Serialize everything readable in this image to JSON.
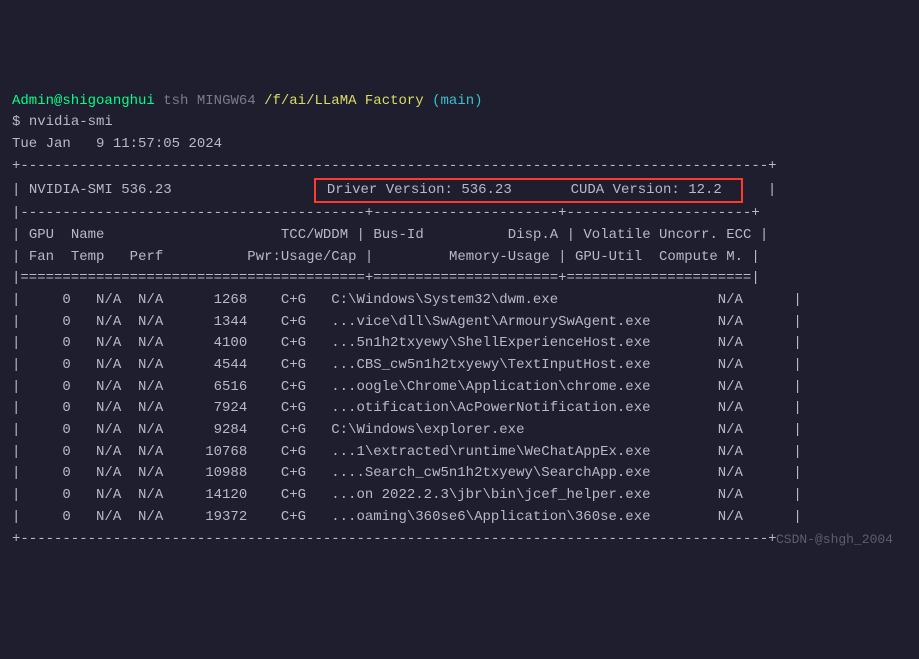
{
  "ps1": {
    "user_host": "Admin@shigoanghui",
    "shell": "tsh",
    "sys": "MINGW64",
    "cwd": "/f/ai/LLaMA Factory",
    "branch": "(main)"
  },
  "prompt": "$ ",
  "command": "nvidia-smi",
  "date": "Tue Jan   9 11:57:05 2024",
  "smi_label": "NVIDIA-SMI",
  "smi_version": "536.23",
  "driver_label": "Driver Version:",
  "driver_version": "536.23",
  "cuda_label": "CUDA Version:",
  "cuda_version": "12.2",
  "hdr": {
    "gpu": "GPU",
    "name": "Name",
    "tccwddm": "TCC/WDDM",
    "busid": "Bus-Id",
    "dispa": "Disp.A",
    "volatile": "Volatile",
    "uncorr_ecc": "Uncorr. ECC",
    "fan": "Fan",
    "temp": "Temp",
    "perf": "Perf",
    "pwr": "Pwr:Usage/Cap",
    "memusage": "Memory-Usage",
    "gpuutil": "GPU-Util",
    "computem": "Compute M."
  },
  "procs": [
    {
      "gpu": "0",
      "col1": "N/A",
      "col2": "N/A",
      "pid": "1268",
      "type": "C+G",
      "path": "C:\\Windows\\System32\\dwm.exe",
      "mem": "N/A"
    },
    {
      "gpu": "0",
      "col1": "N/A",
      "col2": "N/A",
      "pid": "1344",
      "type": "C+G",
      "path": "...vice\\dll\\SwAgent\\ArmourySwAgent.exe",
      "mem": "N/A"
    },
    {
      "gpu": "0",
      "col1": "N/A",
      "col2": "N/A",
      "pid": "4100",
      "type": "C+G",
      "path": "...5n1h2txyewy\\ShellExperienceHost.exe",
      "mem": "N/A"
    },
    {
      "gpu": "0",
      "col1": "N/A",
      "col2": "N/A",
      "pid": "4544",
      "type": "C+G",
      "path": "...CBS_cw5n1h2txyewy\\TextInputHost.exe",
      "mem": "N/A"
    },
    {
      "gpu": "0",
      "col1": "N/A",
      "col2": "N/A",
      "pid": "6516",
      "type": "C+G",
      "path": "...oogle\\Chrome\\Application\\chrome.exe",
      "mem": "N/A"
    },
    {
      "gpu": "0",
      "col1": "N/A",
      "col2": "N/A",
      "pid": "7924",
      "type": "C+G",
      "path": "...otification\\AcPowerNotification.exe",
      "mem": "N/A"
    },
    {
      "gpu": "0",
      "col1": "N/A",
      "col2": "N/A",
      "pid": "9284",
      "type": "C+G",
      "path": "C:\\Windows\\explorer.exe",
      "mem": "N/A"
    },
    {
      "gpu": "0",
      "col1": "N/A",
      "col2": "N/A",
      "pid": "10768",
      "type": "C+G",
      "path": "...1\\extracted\\runtime\\WeChatAppEx.exe",
      "mem": "N/A"
    },
    {
      "gpu": "0",
      "col1": "N/A",
      "col2": "N/A",
      "pid": "10988",
      "type": "C+G",
      "path": "....Search_cw5n1h2txyewy\\SearchApp.exe",
      "mem": "N/A"
    },
    {
      "gpu": "0",
      "col1": "N/A",
      "col2": "N/A",
      "pid": "14120",
      "type": "C+G",
      "path": "...on 2022.2.3\\jbr\\bin\\jcef_helper.exe",
      "mem": "N/A"
    },
    {
      "gpu": "0",
      "col1": "N/A",
      "col2": "N/A",
      "pid": "19372",
      "type": "C+G",
      "path": "...oaming\\360se6\\Application\\360se.exe",
      "mem": "N/A"
    }
  ],
  "watermark": "CSDN-@shgh_2004"
}
